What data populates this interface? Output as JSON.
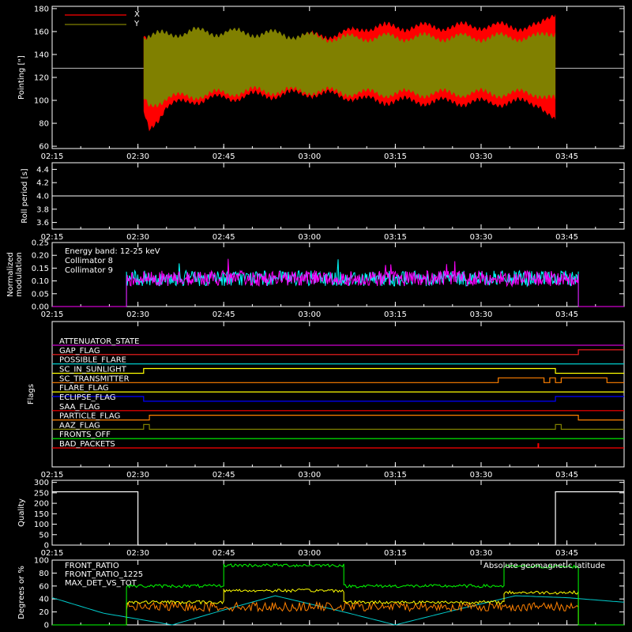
{
  "chart_data": [
    {
      "type": "line",
      "title": "",
      "ylabel": "Pointing [\"]",
      "ylim": [
        58,
        182
      ],
      "yticks": [
        "60",
        "80",
        "100",
        "120",
        "140",
        "160",
        "180"
      ],
      "xticks": [
        "02:15",
        "02:30",
        "02:45",
        "03:00",
        "03:15",
        "03:30",
        "03:45"
      ],
      "xlim": [
        "02:15",
        "03:55"
      ],
      "reference_line": 128,
      "series": [
        {
          "name": "X",
          "color": "#ff0000",
          "time": [
            "02:31",
            "02:32",
            "02:35",
            "02:40",
            "02:50",
            "03:00",
            "03:06",
            "03:10",
            "03:20",
            "03:30",
            "03:40",
            "03:43"
          ],
          "upper": [
            158,
            154,
            154,
            155,
            155,
            156,
            158,
            164,
            164,
            165,
            164,
            178
          ],
          "lower": [
            88,
            74,
            95,
            100,
            104,
            106,
            104,
            100,
            99,
            98,
            98,
            80
          ]
        },
        {
          "name": "Y",
          "color": "#808000",
          "time": [
            "02:31",
            "02:32",
            "02:35",
            "02:40",
            "02:50",
            "03:00",
            "03:06",
            "03:10",
            "03:20",
            "03:30",
            "03:40",
            "03:43"
          ],
          "upper": [
            156,
            156,
            158,
            160,
            159,
            156,
            154,
            155,
            155,
            155,
            155,
            160
          ],
          "lower": [
            100,
            95,
            102,
            104,
            108,
            108,
            107,
            106,
            106,
            106,
            106,
            100
          ]
        }
      ]
    },
    {
      "type": "line",
      "ylabel": "Roll period [s]",
      "ylim": [
        3.5,
        4.5
      ],
      "yticks": [
        "3.6",
        "3.8",
        "4.0",
        "4.2",
        "4.4"
      ],
      "xticks": [
        "02:15",
        "02:30",
        "02:45",
        "03:00",
        "03:15",
        "03:30",
        "03:45"
      ],
      "series": [
        {
          "name": "",
          "color": "#ffffff",
          "value": 4.0
        }
      ]
    },
    {
      "type": "line",
      "ylabel": "Normalized modulation",
      "ylim": [
        0,
        0.25
      ],
      "yticks": [
        "0.00",
        "0.05",
        "0.10",
        "0.15",
        "0.20",
        "0.25"
      ],
      "xticks": [
        "02:15",
        "02:30",
        "02:45",
        "03:00",
        "03:15",
        "03:30",
        "03:45"
      ],
      "annotation": "Energy band: 12-25 keV",
      "series": [
        {
          "name": "Collimator 8",
          "color": "#00ffff",
          "start": "02:28",
          "end": "03:47",
          "mean": 0.11
        },
        {
          "name": "Collimator 9",
          "color": "#ff00ff",
          "start": "02:28",
          "end": "03:47",
          "mean": 0.11
        }
      ]
    },
    {
      "type": "line",
      "ylabel": "Flags",
      "xticks": [
        "02:15",
        "02:30",
        "02:45",
        "03:00",
        "03:15",
        "03:30",
        "03:45"
      ],
      "series": [
        {
          "name": "ATTENUATOR_STATE",
          "color": "#cc00cc",
          "states": []
        },
        {
          "name": "GAP_FLAG",
          "color": "#ff2020",
          "states": [
            {
              "t": "03:47",
              "v": 1
            }
          ]
        },
        {
          "name": "POSSIBLE_FLARE",
          "color": "#00cccc",
          "states": []
        },
        {
          "name": "SC_IN_SUNLIGHT",
          "color": "#ffff00",
          "states": [
            {
              "t": "02:16",
              "v": 0
            },
            {
              "t": "02:31",
              "v": 1
            },
            {
              "t": "03:43",
              "v": 0
            }
          ]
        },
        {
          "name": "SC_TRANSMITTER",
          "color": "#ff8000",
          "states": [
            {
              "t": "03:33",
              "v": 1
            },
            {
              "t": "03:41",
              "v": 0
            },
            {
              "t": "03:42",
              "v": 1
            },
            {
              "t": "03:43",
              "v": 0
            },
            {
              "t": "03:44",
              "v": 1
            },
            {
              "t": "03:52",
              "v": 0
            }
          ]
        },
        {
          "name": "FLARE_FLAG",
          "color": "#ffff00",
          "states": []
        },
        {
          "name": "ECLIPSE_FLAG",
          "color": "#0000ff",
          "states": [
            {
              "t": "02:15",
              "v": 1
            },
            {
              "t": "02:31",
              "v": 0
            },
            {
              "t": "03:43",
              "v": 1
            }
          ]
        },
        {
          "name": "SAA_FLAG",
          "color": "#ff0000",
          "states": []
        },
        {
          "name": "PARTICLE_FLAG",
          "color": "#ff8000",
          "states": [
            {
              "t": "02:32",
              "v": 1
            },
            {
              "t": "03:47",
              "v": 0
            }
          ]
        },
        {
          "name": "AAZ_FLAG",
          "color": "#808000",
          "states": [
            {
              "t": "02:31",
              "v": 1
            },
            {
              "t": "02:32",
              "v": 0
            },
            {
              "t": "03:43",
              "v": 1
            },
            {
              "t": "03:44",
              "v": 0
            }
          ]
        },
        {
          "name": "FRONTS_OFF",
          "color": "#00ff00",
          "states": []
        },
        {
          "name": "BAD_PACKETS",
          "color": "#ff0000",
          "states": [
            {
              "t": "03:40",
              "v": 1
            }
          ]
        }
      ]
    },
    {
      "type": "line",
      "ylabel": "Quality",
      "ylim": [
        0,
        310
      ],
      "yticks": [
        "0",
        "50",
        "100",
        "150",
        "200",
        "250",
        "300"
      ],
      "xticks": [
        "02:15",
        "02:30",
        "02:45",
        "03:00",
        "03:15",
        "03:30",
        "03:45"
      ],
      "series": [
        {
          "name": "",
          "color": "#ffffff",
          "time": [
            "02:15",
            "02:30",
            "02:30",
            "03:43",
            "03:43",
            "03:55"
          ],
          "values": [
            255,
            255,
            0,
            0,
            255,
            255
          ]
        }
      ]
    },
    {
      "type": "line",
      "ylabel": "Degrees or %",
      "ylim": [
        0,
        100
      ],
      "yticks": [
        "0",
        "20",
        "40",
        "60",
        "80",
        "100"
      ],
      "series": [
        {
          "name": "FRONT_RATIO",
          "color": "#ffff00",
          "levels": [
            {
              "t0": "02:28",
              "t1": "02:45",
              "v": 35
            },
            {
              "t0": "02:45",
              "t1": "03:06",
              "v": 53
            },
            {
              "t0": "03:06",
              "t1": "03:34",
              "v": 35
            },
            {
              "t0": "03:34",
              "t1": "03:47",
              "v": 50
            }
          ]
        },
        {
          "name": "FRONT_RATIO_1225",
          "color": "#00ff00",
          "levels": [
            {
              "t0": "02:28",
              "t1": "02:45",
              "v": 60
            },
            {
              "t0": "02:45",
              "t1": "03:06",
              "v": 92
            },
            {
              "t0": "03:06",
              "t1": "03:34",
              "v": 60
            },
            {
              "t0": "03:34",
              "t1": "03:47",
              "v": 90
            }
          ]
        },
        {
          "name": "MAX_DET_VS_TOT",
          "color": "#ff8000",
          "levels": [
            {
              "t0": "02:28",
              "t1": "03:47",
              "v": 28
            }
          ]
        },
        {
          "name": "Absolute geomagnetic latitude",
          "color": "#00cccc",
          "time": [
            "02:15",
            "02:24",
            "02:36",
            "02:45",
            "02:54",
            "03:06",
            "03:15",
            "03:25",
            "03:36",
            "03:45",
            "03:55"
          ],
          "values": [
            42,
            18,
            0,
            23,
            45,
            20,
            0,
            22,
            45,
            42,
            35
          ]
        }
      ]
    }
  ]
}
